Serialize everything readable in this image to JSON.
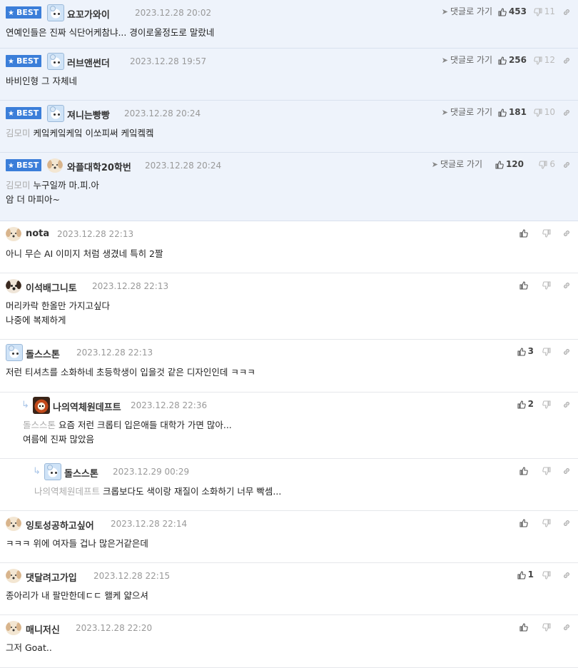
{
  "best_label": "BEST",
  "goto_label": "댓글로 가기",
  "comments": [
    {
      "best": true,
      "avatar": "bear",
      "nick": "요꼬가와이",
      "date": "2023.12.28 20:02",
      "lines": [
        "연예인들은 진짜 식단어케참냐... 경이로울정도로 말랐네"
      ],
      "mention": "",
      "likes": "453",
      "dislikes": "11"
    },
    {
      "best": true,
      "avatar": "bear",
      "nick": "러브앤썬더",
      "date": "2023.12.28 19:57",
      "lines": [
        "바비인형 그 자체네"
      ],
      "mention": "",
      "likes": "256",
      "dislikes": "12"
    },
    {
      "best": true,
      "avatar": "bear",
      "nick": "져니는빵빵",
      "date": "2023.12.28 20:24",
      "lines": [
        "케잌케잌케잌 이쏘피써 케잌켘켘"
      ],
      "mention": "김모미",
      "likes": "181",
      "dislikes": "10"
    },
    {
      "best": true,
      "avatar": "dog",
      "nick": "와플대학20학번",
      "date": "2023.12.28 20:24",
      "lines": [
        "누구일까 마.피.아",
        "암 더 마피아~"
      ],
      "mention": "김모미",
      "likes": "120",
      "dislikes": "6"
    },
    {
      "best": false,
      "avatar": "dog",
      "nick": "nota",
      "date": "2023.12.28 22:13",
      "lines": [
        "아니 무슨 AI 이미지 처럼 생겼네 특히 2짤"
      ],
      "mention": "",
      "likes": "",
      "dislikes": ""
    },
    {
      "best": false,
      "avatar": "dogdark",
      "nick": "이석배그니토",
      "date": "2023.12.28 22:13",
      "lines": [
        "머리카락 한올만 가지고싶다",
        "나중에 복제하게"
      ],
      "mention": "",
      "likes": "",
      "dislikes": ""
    },
    {
      "best": false,
      "avatar": "bear",
      "nick": "돌스스톤",
      "date": "2023.12.28 22:13",
      "lines": [
        "저런 티셔츠를 소화하네 초등학생이 입을것 같은 디자인인데 ㅋㅋㅋ"
      ],
      "mention": "",
      "likes": "3",
      "dislikes": ""
    },
    {
      "best": false,
      "reply": 1,
      "avatar": "lion",
      "nick": "나의역체원데프트",
      "date": "2023.12.28 22:36",
      "lines": [
        "요즘 저런 크롭티 입은애들 대학가 가면 많아...",
        "여름에 진짜 많았음"
      ],
      "mention": "돌스스톤",
      "likes": "2",
      "dislikes": ""
    },
    {
      "best": false,
      "reply": 2,
      "avatar": "bear",
      "nick": "돌스스톤",
      "date": "2023.12.29 00:29",
      "lines": [
        "크롭보다도 색이랑 재질이 소화하기 너무 빡셈..."
      ],
      "mention": "나의역체원데프트",
      "likes": "",
      "dislikes": ""
    },
    {
      "best": false,
      "avatar": "dog",
      "nick": "잉토성공하고싶어",
      "date": "2023.12.28 22:14",
      "lines": [
        "ㅋㅋㅋ 위에 여자들 겁나 많은거같은데"
      ],
      "mention": "",
      "likes": "",
      "dislikes": ""
    },
    {
      "best": false,
      "avatar": "dog",
      "nick": "댓달려고가입",
      "date": "2023.12.28 22:15",
      "lines": [
        "종아리가 내 팔만한데ㄷㄷ 왤케 얇으셔"
      ],
      "mention": "",
      "likes": "1",
      "dislikes": ""
    },
    {
      "best": false,
      "avatar": "dog",
      "nick": "매니저신",
      "date": "2023.12.28 22:20",
      "lines": [
        "그저 Goat.."
      ],
      "mention": "",
      "likes": "",
      "dislikes": ""
    }
  ]
}
